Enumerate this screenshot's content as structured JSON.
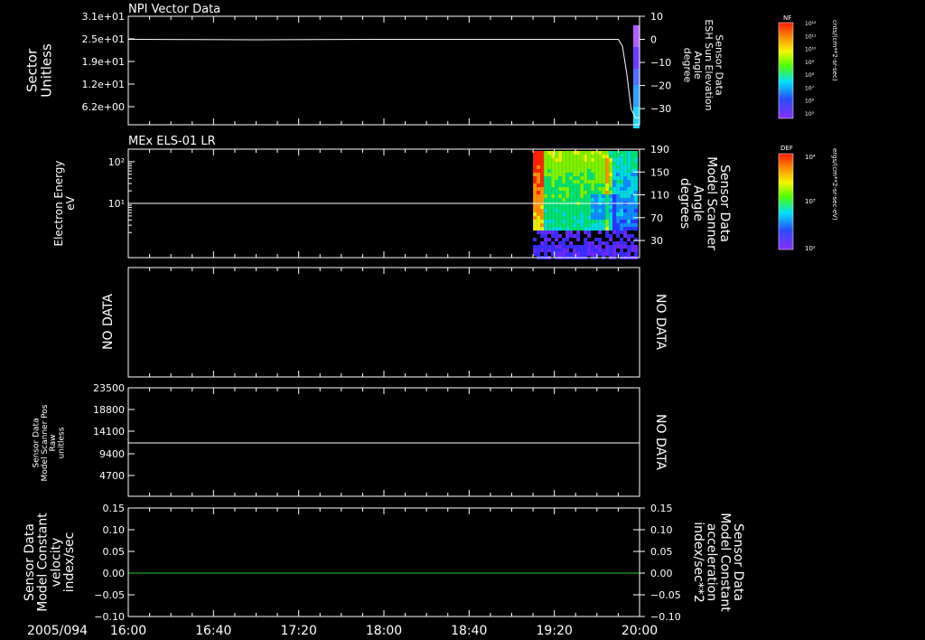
{
  "date_label": "2005/094",
  "time_axis": {
    "ticks": [
      "16:00",
      "16:40",
      "17:20",
      "18:00",
      "18:40",
      "19:20",
      "20:00"
    ]
  },
  "panels": {
    "p1": {
      "title": "NPI Vector Data",
      "left_label": [
        "Sector",
        "Unitless"
      ],
      "left_ticks": [
        "3.1e+01",
        "2.5e+01",
        "1.9e+01",
        "1.2e+01",
        "6.2e+00"
      ],
      "right_label": [
        "Sensor Data",
        "ESH Sun Elevation",
        "Angle",
        "degree"
      ],
      "right_ticks": [
        "10",
        "0",
        "−10",
        "−20",
        "−30"
      ],
      "colorbar": {
        "tag": "NF",
        "top": "10¹²",
        "bottom": "10⁵",
        "units": "cnts/(cm**2-sr-sec)",
        "labels": [
          "10¹²",
          "10¹¹",
          "10¹⁰",
          "10⁹",
          "10⁸",
          "10⁷",
          "10⁶",
          "10⁵"
        ]
      }
    },
    "p2": {
      "title": "MEx ELS-01 LR",
      "left_label": [
        "Electron Energy",
        "eV"
      ],
      "left_ticks": [
        "10²",
        "10¹"
      ],
      "right_label": [
        "Sensor Data",
        "Model Scanner",
        "Angle",
        "degrees"
      ],
      "right_ticks": [
        "190",
        "150",
        "110",
        "70",
        "30"
      ],
      "colorbar": {
        "tag": "DEF",
        "top": "10⁴",
        "mid": "10³",
        "bottom": "10²",
        "units": "ergs/(cm**2-sr-sec-eV)"
      }
    },
    "p3": {
      "left_label": "NO DATA",
      "right_label": "NO DATA"
    },
    "p4": {
      "left_label": [
        "Sensor Data",
        "Model Scanner Pos",
        "Raw",
        "unitless"
      ],
      "left_ticks": [
        "23500",
        "18800",
        "14100",
        "9400",
        "4700"
      ],
      "right_label": "NO DATA"
    },
    "p5": {
      "left_label": [
        "Sensor Data",
        "Model Constant",
        "velocity",
        "index/sec"
      ],
      "left_ticks": [
        "0.15",
        "0.10",
        "0.05",
        "0.00",
        "−0.05",
        "−0.10"
      ],
      "right_label": [
        "Sensor Data",
        "Model Constant",
        "acceleration",
        "index/sec**2"
      ],
      "right_ticks": [
        "0.15",
        "0.10",
        "0.05",
        "0.00",
        "−0.05",
        "−0.10"
      ]
    }
  },
  "chart_data": [
    {
      "type": "line",
      "title": "NPI Vector Data",
      "ylabel": "Sector Unitless",
      "y2label": "Sensor Data ESH Sun Elevation Angle degree",
      "xlim": [
        "16:00",
        "20:00"
      ],
      "ylim": [
        0,
        31
      ],
      "y2lim": [
        -37,
        10
      ],
      "series": [
        {
          "name": "Sensor Data ESH Sun Elevation Angle",
          "axis": "right",
          "x": [
            "16:00",
            "17:00",
            "18:00",
            "19:00",
            "19:50",
            "19:52",
            "19:54",
            "19:56",
            "19:58",
            "20:00"
          ],
          "y": [
            0,
            -0.2,
            0,
            0,
            0,
            -3,
            -15,
            -30,
            -34,
            -34
          ]
        }
      ],
      "spectrogram_strip": {
        "x_start": "19:57",
        "x_end": "20:00",
        "colors": [
          "#b25fff",
          "#6d3cff",
          "#4f6fff",
          "#2aa0ff",
          "#22d8ff"
        ]
      }
    },
    {
      "type": "heatmap",
      "title": "MEx ELS-01 LR",
      "ylabel": "Electron Energy eV",
      "y2label": "Sensor Data Model Scanner Angle degrees",
      "xlim": [
        "16:00",
        "20:00"
      ],
      "ylog": true,
      "ylim": [
        0.5,
        200
      ],
      "y2lim": [
        0,
        190
      ],
      "spectrogram": {
        "x_start": "19:10",
        "x_end": "19:59",
        "y_top": 200,
        "y_bottom": 0.5,
        "hot_bands": [
          "19:10",
          "19:45"
        ]
      },
      "series": [
        {
          "name": "Sensor Data Model Scanner Angle",
          "axis": "right",
          "x": [
            "16:00",
            "20:00"
          ],
          "y": [
            90,
            90
          ]
        }
      ]
    },
    {
      "type": "line",
      "ylabel": "Sensor Data Model Scanner Pos Raw unitless",
      "xlim": [
        "16:00",
        "20:00"
      ],
      "ylim": [
        0,
        23500
      ],
      "series": [
        {
          "name": "Sensor Data Model Scanner Pos Raw",
          "x": [
            "16:00",
            "20:00"
          ],
          "y": [
            11800,
            11800
          ]
        }
      ]
    },
    {
      "type": "line",
      "ylabel": "Sensor Data Model Constant velocity index/sec",
      "y2label": "Sensor Data Model Constant acceleration index/sec**2",
      "xlim": [
        "16:00",
        "20:00"
      ],
      "ylim": [
        -0.1,
        0.15
      ],
      "series": [
        {
          "name": "Sensor Data Model Constant acceleration",
          "x": [
            "16:00",
            "20:00"
          ],
          "y": [
            0,
            0
          ],
          "color": "#22cc22"
        }
      ]
    }
  ]
}
